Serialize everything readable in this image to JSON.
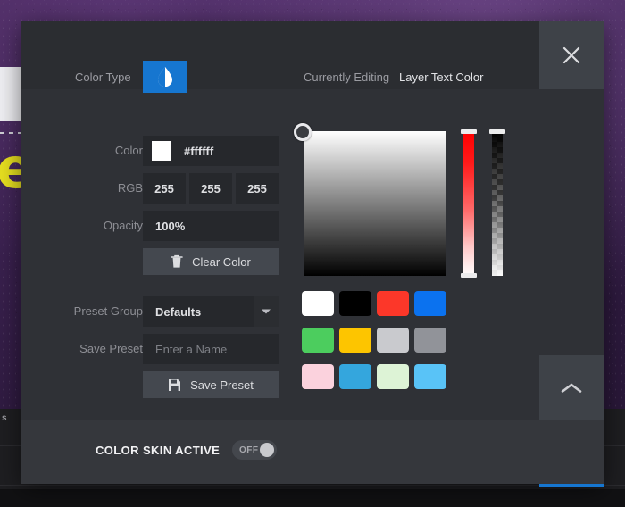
{
  "background": {
    "artwork_letter": "e",
    "status_letter": "s"
  },
  "header": {
    "color_type_label": "Color Type",
    "color_type_icon": "droplet-half-icon",
    "currently_editing_label": "Currently Editing",
    "currently_editing_value": "Layer Text Color",
    "close_icon": "close-icon",
    "accent": "#1676d0"
  },
  "form": {
    "color": {
      "label": "Color",
      "value": "#ffffff",
      "swatch": "#ffffff"
    },
    "rgb": {
      "label": "RGB",
      "r": "255",
      "g": "255",
      "b": "255"
    },
    "opacity": {
      "label": "Opacity",
      "value": "100%"
    },
    "clear_color": {
      "label": "Clear Color",
      "icon": "trash-icon"
    },
    "preset_group": {
      "label": "Preset Group",
      "value": "Defaults",
      "caret_icon": "chevron-down-icon"
    },
    "save_preset_field": {
      "label": "Save Preset",
      "placeholder": "Enter a Name",
      "value": ""
    },
    "save_preset_button": {
      "label": "Save Preset",
      "icon": "save-disk-icon"
    }
  },
  "picker": {
    "sv_area_name": "saturation-value-area",
    "hue_slider_name": "hue-slider",
    "alpha_slider_name": "alpha-slider",
    "handle_position": "top-left"
  },
  "swatches": [
    {
      "name": "white",
      "hex": "#ffffff"
    },
    {
      "name": "black",
      "hex": "#000000"
    },
    {
      "name": "red",
      "hex": "#fc3729"
    },
    {
      "name": "blue",
      "hex": "#0b72ef"
    },
    {
      "name": "green",
      "hex": "#4ccd5e"
    },
    {
      "name": "yellow",
      "hex": "#fdc500"
    },
    {
      "name": "light-gray",
      "hex": "#c9cace"
    },
    {
      "name": "gray",
      "hex": "#919399"
    },
    {
      "name": "pink",
      "hex": "#fbd2dd"
    },
    {
      "name": "cyan-blue",
      "hex": "#34a6dd"
    },
    {
      "name": "mint",
      "hex": "#ddf3d6"
    },
    {
      "name": "sky",
      "hex": "#59c3f7"
    }
  ],
  "actions": {
    "collapse_icon": "chevron-up-icon",
    "confirm_icon": "check-icon"
  },
  "footer": {
    "title": "COLOR SKIN ACTIVE",
    "toggle_state": "OFF"
  }
}
